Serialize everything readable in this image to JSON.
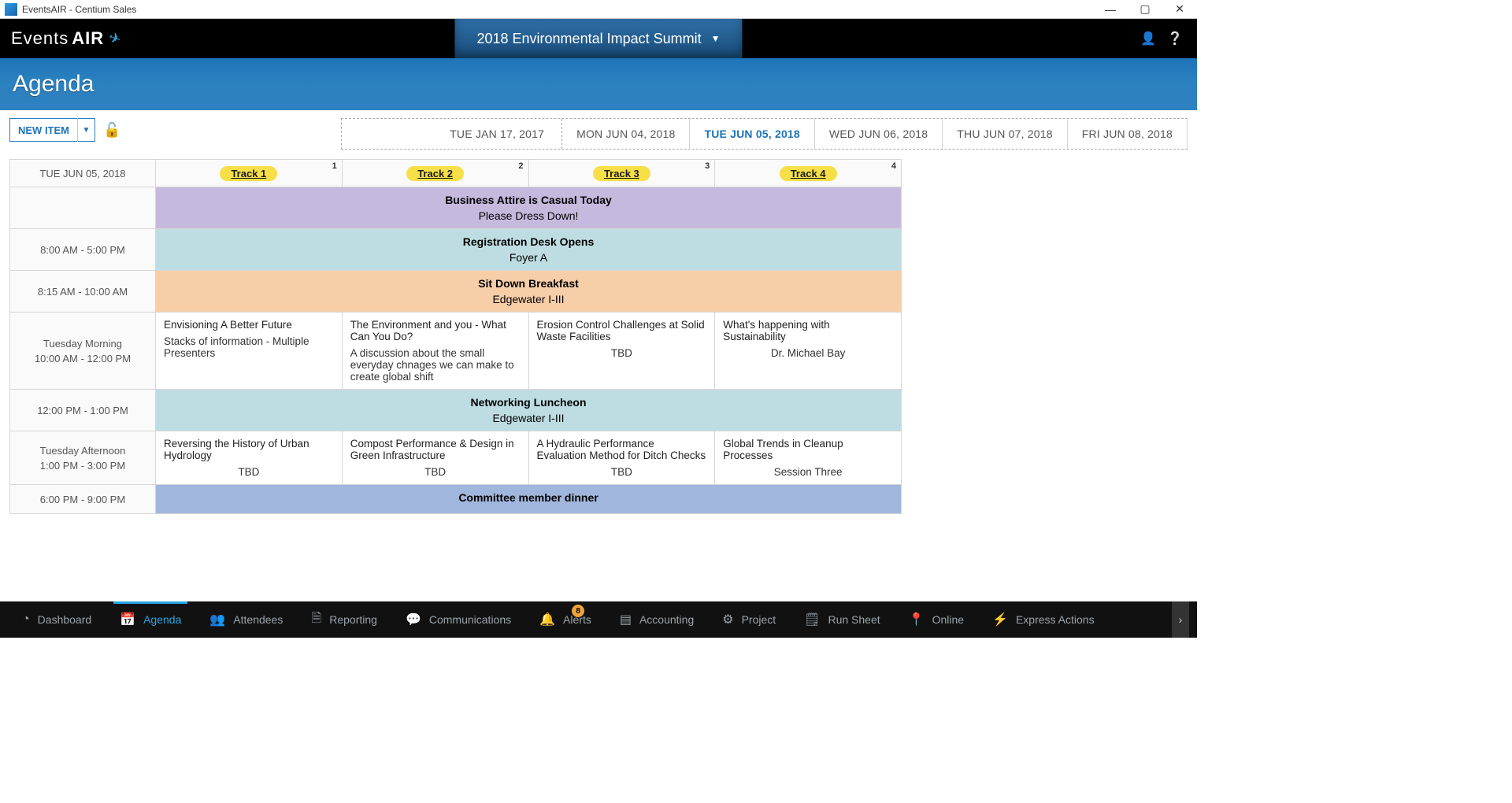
{
  "window": {
    "title": "EventsAIR - Centium Sales"
  },
  "logo": {
    "word1": "Events",
    "word2": "AIR"
  },
  "event_selector": {
    "label": "2018 Environmental Impact Summit"
  },
  "page_title": "Agenda",
  "new_item": {
    "label": "NEW ITEM"
  },
  "date_tabs": [
    {
      "label": "TUE JAN 17, 2017",
      "active": false,
      "wide": true
    },
    {
      "label": "MON JUN 04, 2018",
      "active": false
    },
    {
      "label": "TUE JUN 05, 2018",
      "active": true
    },
    {
      "label": "WED JUN 06, 2018",
      "active": false
    },
    {
      "label": "THU JUN 07, 2018",
      "active": false
    },
    {
      "label": "FRI JUN 08, 2018",
      "active": false
    }
  ],
  "grid": {
    "current_date": "TUE JUN 05, 2018",
    "tracks": [
      {
        "num": "1",
        "label": "Track 1"
      },
      {
        "num": "2",
        "label": "Track 2"
      },
      {
        "num": "3",
        "label": "Track 3"
      },
      {
        "num": "4",
        "label": "Track 4"
      }
    ],
    "rows": [
      {
        "time": "",
        "full": {
          "title": "Business Attire is Casual Today",
          "sub": "Please Dress Down!",
          "bg": "purple"
        }
      },
      {
        "time": "8:00 AM - 5:00 PM",
        "full": {
          "title": "Registration Desk Opens",
          "sub": "Foyer A",
          "bg": "teal"
        }
      },
      {
        "time": "8:15 AM - 10:00 AM",
        "full": {
          "title": "Sit Down Breakfast",
          "sub": "Edgewater I-III",
          "bg": "peach"
        }
      },
      {
        "label": "Tuesday Morning",
        "time": "10:00 AM - 12:00 PM",
        "cells": [
          {
            "title": "Envisioning A Better Future",
            "sub": "Stacks of information - Multiple Presenters"
          },
          {
            "title": "The Environment and you - What Can You Do?",
            "sub": "A discussion about the small everyday chnages we can make to create global shift"
          },
          {
            "title": "Erosion Control Challenges at Solid Waste Facilities",
            "sub": "TBD",
            "sub_center": true
          },
          {
            "title": "What's happening with Sustainability",
            "sub": "Dr. Michael Bay",
            "sub_center": true
          }
        ]
      },
      {
        "time": "12:00 PM - 1:00 PM",
        "full": {
          "title": "Networking Luncheon",
          "sub": "Edgewater I-III",
          "bg": "teal"
        }
      },
      {
        "label": "Tuesday Afternoon",
        "time": "1:00 PM - 3:00 PM",
        "cells": [
          {
            "title": "Reversing the History of Urban Hydrology",
            "sub": "TBD",
            "sub_center": true
          },
          {
            "title": "Compost Performance & Design in Green Infrastructure",
            "sub": "TBD",
            "sub_center": true
          },
          {
            "title": "A Hydraulic Performance Evaluation Method for Ditch Checks",
            "sub": "TBD",
            "sub_center": true
          },
          {
            "title": "Global Trends in Cleanup Processes",
            "sub": "Session Three",
            "sub_center": true
          }
        ]
      },
      {
        "time": "6:00 PM - 9:00 PM",
        "full": {
          "title": "Committee member dinner",
          "sub": "",
          "bg": "blue"
        }
      }
    ]
  },
  "bottom_nav": [
    {
      "icon": "◔",
      "label": "Dashboard"
    },
    {
      "icon": "📅",
      "label": "Agenda",
      "active": true
    },
    {
      "icon": "👥",
      "label": "Attendees"
    },
    {
      "icon": "🗎",
      "label": "Reporting"
    },
    {
      "icon": "💬",
      "label": "Communications"
    },
    {
      "icon": "🔔",
      "label": "Alerts",
      "badge": "8"
    },
    {
      "icon": "▤",
      "label": "Accounting"
    },
    {
      "icon": "⚙",
      "label": "Project"
    },
    {
      "icon": "🗒",
      "label": "Run Sheet"
    },
    {
      "icon": "📍",
      "label": "Online"
    },
    {
      "icon": "⚡",
      "label": "Express Actions"
    }
  ]
}
